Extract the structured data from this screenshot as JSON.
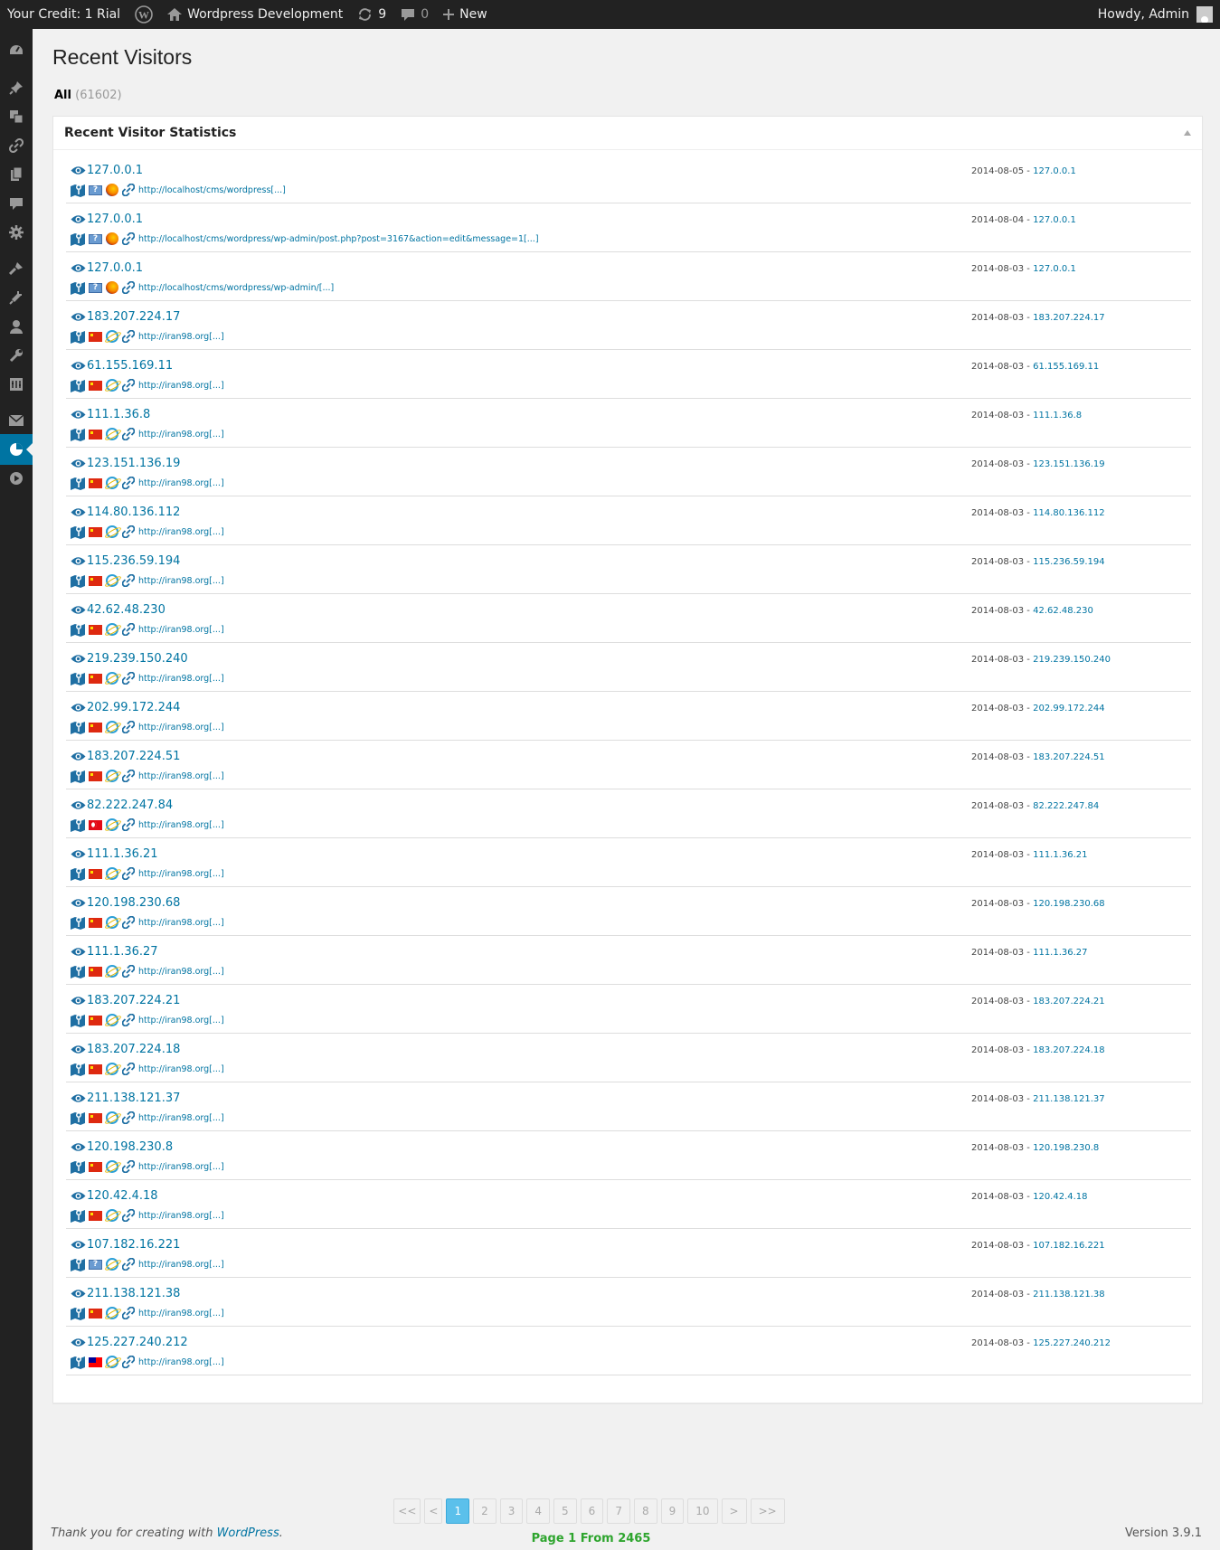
{
  "adminbar": {
    "credit": "Your Credit: 1 Rial",
    "site_name": "Wordpress Development",
    "updates_count": "9",
    "comments_count": "0",
    "new_label": "New",
    "howdy": "Howdy, Admin"
  },
  "page": {
    "title": "Recent Visitors",
    "filter_all": "All",
    "filter_count": "(61602)"
  },
  "postbox": {
    "title": "Recent Visitor Statistics"
  },
  "visitors": [
    {
      "ip": "127.0.0.1",
      "date": "2014-08-05",
      "flag": "unknown",
      "browser": "firefox",
      "referrer": "http://localhost/cms/wordpress[...]"
    },
    {
      "ip": "127.0.0.1",
      "date": "2014-08-04",
      "flag": "unknown",
      "browser": "firefox",
      "referrer": "http://localhost/cms/wordpress/wp-admin/post.php?post=3167&action=edit&message=1[...]"
    },
    {
      "ip": "127.0.0.1",
      "date": "2014-08-03",
      "flag": "unknown",
      "browser": "firefox",
      "referrer": "http://localhost/cms/wordpress/wp-admin/[...]"
    },
    {
      "ip": "183.207.224.17",
      "date": "2014-08-03",
      "flag": "cn",
      "browser": "ie",
      "referrer": "http://iran98.org[...]"
    },
    {
      "ip": "61.155.169.11",
      "date": "2014-08-03",
      "flag": "cn",
      "browser": "ie",
      "referrer": "http://iran98.org[...]"
    },
    {
      "ip": "111.1.36.8",
      "date": "2014-08-03",
      "flag": "cn",
      "browser": "ie",
      "referrer": "http://iran98.org[...]"
    },
    {
      "ip": "123.151.136.19",
      "date": "2014-08-03",
      "flag": "cn",
      "browser": "ie",
      "referrer": "http://iran98.org[...]"
    },
    {
      "ip": "114.80.136.112",
      "date": "2014-08-03",
      "flag": "cn",
      "browser": "ie",
      "referrer": "http://iran98.org[...]"
    },
    {
      "ip": "115.236.59.194",
      "date": "2014-08-03",
      "flag": "cn",
      "browser": "ie",
      "referrer": "http://iran98.org[...]"
    },
    {
      "ip": "42.62.48.230",
      "date": "2014-08-03",
      "flag": "cn",
      "browser": "ie",
      "referrer": "http://iran98.org[...]"
    },
    {
      "ip": "219.239.150.240",
      "date": "2014-08-03",
      "flag": "cn",
      "browser": "ie",
      "referrer": "http://iran98.org[...]"
    },
    {
      "ip": "202.99.172.244",
      "date": "2014-08-03",
      "flag": "cn",
      "browser": "ie",
      "referrer": "http://iran98.org[...]"
    },
    {
      "ip": "183.207.224.51",
      "date": "2014-08-03",
      "flag": "cn",
      "browser": "ie",
      "referrer": "http://iran98.org[...]"
    },
    {
      "ip": "82.222.247.84",
      "date": "2014-08-03",
      "flag": "tr",
      "browser": "ie",
      "referrer": "http://iran98.org[...]"
    },
    {
      "ip": "111.1.36.21",
      "date": "2014-08-03",
      "flag": "cn",
      "browser": "ie",
      "referrer": "http://iran98.org[...]"
    },
    {
      "ip": "120.198.230.68",
      "date": "2014-08-03",
      "flag": "cn",
      "browser": "ie",
      "referrer": "http://iran98.org[...]"
    },
    {
      "ip": "111.1.36.27",
      "date": "2014-08-03",
      "flag": "cn",
      "browser": "ie",
      "referrer": "http://iran98.org[...]"
    },
    {
      "ip": "183.207.224.21",
      "date": "2014-08-03",
      "flag": "cn",
      "browser": "ie",
      "referrer": "http://iran98.org[...]"
    },
    {
      "ip": "183.207.224.18",
      "date": "2014-08-03",
      "flag": "cn",
      "browser": "ie",
      "referrer": "http://iran98.org[...]"
    },
    {
      "ip": "211.138.121.37",
      "date": "2014-08-03",
      "flag": "cn",
      "browser": "ie",
      "referrer": "http://iran98.org[...]"
    },
    {
      "ip": "120.198.230.8",
      "date": "2014-08-03",
      "flag": "cn",
      "browser": "ie",
      "referrer": "http://iran98.org[...]"
    },
    {
      "ip": "120.42.4.18",
      "date": "2014-08-03",
      "flag": "cn",
      "browser": "ie",
      "referrer": "http://iran98.org[...]"
    },
    {
      "ip": "107.182.16.221",
      "date": "2014-08-03",
      "flag": "unknown",
      "browser": "ie",
      "referrer": "http://iran98.org[...]"
    },
    {
      "ip": "211.138.121.38",
      "date": "2014-08-03",
      "flag": "cn",
      "browser": "ie",
      "referrer": "http://iran98.org[...]"
    },
    {
      "ip": "125.227.240.212",
      "date": "2014-08-03",
      "flag": "tw",
      "browser": "ie",
      "referrer": "http://iran98.org[...]"
    }
  ],
  "pagination": {
    "first": "<<",
    "prev": "<",
    "pages": [
      "1",
      "2",
      "3",
      "4",
      "5",
      "6",
      "7",
      "8",
      "9",
      "10"
    ],
    "current": "1",
    "next": ">",
    "last": ">>",
    "info": "Page 1 From 2465"
  },
  "footer": {
    "thanks_prefix": "Thank you for creating with ",
    "thanks_link": "WordPress",
    "thanks_suffix": ".",
    "version": "Version 3.9.1"
  },
  "sidebar_icons": [
    "dashboard-icon",
    "pin-icon",
    "media-icon",
    "links-icon",
    "pages-icon",
    "comments-icon",
    "gear-icon",
    "appearance-icon",
    "plugins-icon",
    "users-icon",
    "tools-icon",
    "settings-icon",
    "mail-icon",
    "statistics-icon",
    "play-icon"
  ]
}
